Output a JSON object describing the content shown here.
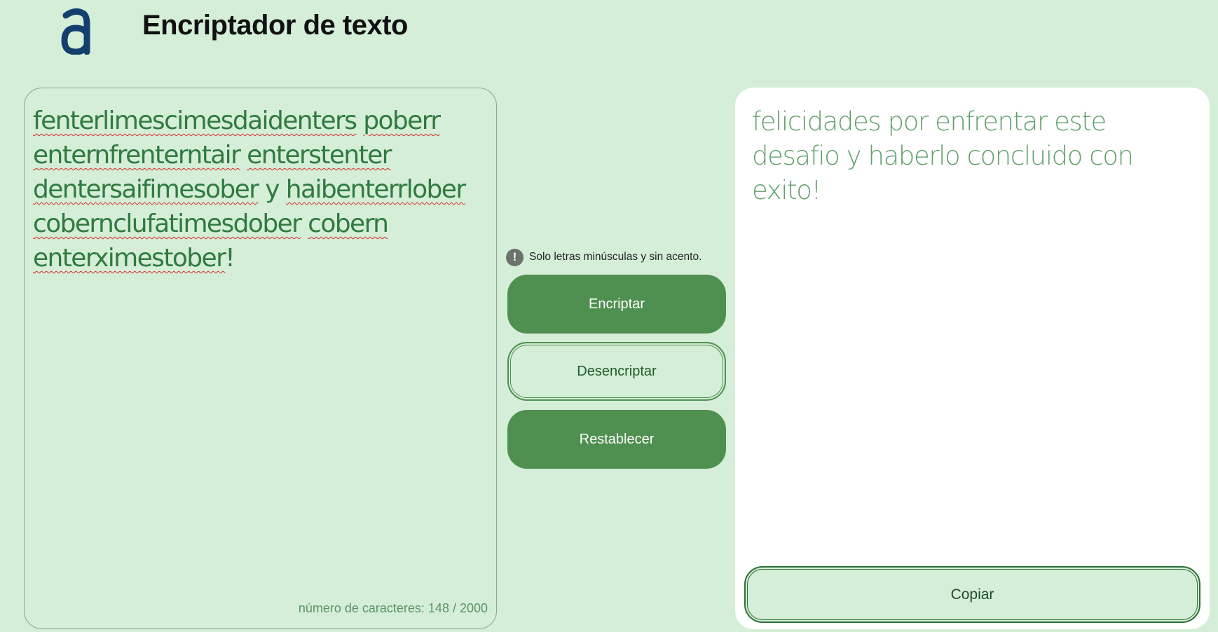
{
  "header": {
    "logo_icon": "letter-a-logo",
    "title": "Encriptador de texto"
  },
  "input": {
    "lines": [
      [
        {
          "t": "fenterlimescimesdaidenters",
          "err": true
        },
        {
          "t": " ",
          "err": false
        },
        {
          "t": "poberr",
          "err": true
        }
      ],
      [
        {
          "t": "enternfrenterntair",
          "err": true
        },
        {
          "t": " ",
          "err": false
        },
        {
          "t": "enterstenter",
          "err": true
        }
      ],
      [
        {
          "t": "dentersaifimesober",
          "err": true
        },
        {
          "t": " y ",
          "err": false
        },
        {
          "t": "haibenterrlober",
          "err": true
        }
      ],
      [
        {
          "t": "cobernclufatimesdober",
          "err": true
        },
        {
          "t": " ",
          "err": false
        },
        {
          "t": "cobern",
          "err": true
        }
      ],
      [
        {
          "t": "enterximestober",
          "err": true
        },
        {
          "t": "!",
          "err": false
        }
      ]
    ],
    "char_count": "número de caracteres: 148 / 2000"
  },
  "controls": {
    "hint_icon": "exclamation-circle-icon",
    "hint_text": "Solo letras minúsculas y sin acento.",
    "encrypt_label": "Encriptar",
    "decrypt_label": "Desencriptar",
    "reset_label": "Restablecer"
  },
  "output": {
    "text": "felicidades por enfrentar este desafio y haberlo concluido con exito!",
    "copy_label": "Copiar"
  },
  "colors": {
    "background": "#d5eed8",
    "primary": "#4f8f50",
    "output_text": "#62a06c",
    "input_text": "#2f7a40"
  }
}
